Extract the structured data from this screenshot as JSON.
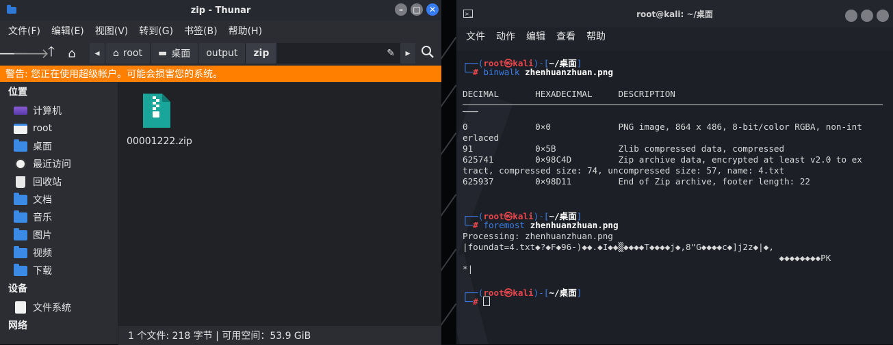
{
  "thunar": {
    "title": "zip - Thunar",
    "menu": [
      "文件(F)",
      "编辑(E)",
      "视图(V)",
      "转到(G)",
      "书签(B)",
      "帮助(H)"
    ],
    "path": [
      "root",
      "桌面",
      "output",
      "zip"
    ],
    "warning": "警告: 您正在使用超级帐户。可能会损害您的系统。",
    "sidebar": {
      "places_heading": "位置",
      "places": [
        "计算机",
        "root",
        "桌面",
        "最近访问",
        "回收站",
        "文档",
        "音乐",
        "图片",
        "视频",
        "下载"
      ],
      "devices_heading": "设备",
      "devices": [
        "文件系统"
      ],
      "network_heading": "网络"
    },
    "file": {
      "name": "00001222.zip"
    },
    "status": "1 个文件: 218 字节  |  可用空间：53.9 GiB"
  },
  "terminal": {
    "title": "root@kali: ~/桌面",
    "menu": [
      "文件",
      "动作",
      "编辑",
      "查看",
      "帮助"
    ],
    "prompt": {
      "user": "root㉿kali",
      "dir": "~/桌面",
      "open": "┌──(",
      "mid": ")-[",
      "close": "]",
      "second": "└─",
      "hash": "#"
    },
    "cmd1_name": "binwalk",
    "cmd1_arg": "zhenhuanzhuan.png",
    "header": "DECIMAL       HEXADECIMAL     DESCRIPTION",
    "underline_tail": "───",
    "rows": [
      "0             0×0             PNG image, 864 x 486, 8-bit/color RGBA, non-int",
      "erlaced",
      "91            0×5B            Zlib compressed data, compressed",
      "625741        0×98C4D         Zip archive data, encrypted at least v2.0 to ex",
      "tract, compressed size: 74, uncompressed size: 57, name: 4.txt",
      "625937        0×98D11         End of Zip archive, footer length: 22"
    ],
    "cmd2_name": "foremost",
    "cmd2_arg": "zhenhuanzhuan.png",
    "out2": [
      "Processing: zhenhuanzhuan.png",
      "|foundat=4.txt◆?◆F◆96-)◆◆.◆I◆◆▒◆◆◆◆T◆◆◆◆j◆,8\"G◆◆◆◆c◆]j2z◆|◆,",
      "                                                             ◆◆◆◆◆◆◆◆PK",
      "*|"
    ]
  }
}
